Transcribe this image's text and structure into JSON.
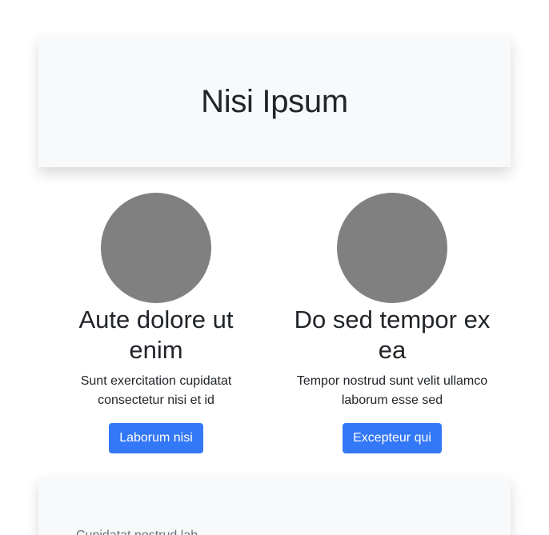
{
  "hero": {
    "title": "Nisi Ipsum"
  },
  "features": [
    {
      "title": "Aute dolore ut enim",
      "text": "Sunt exercitation cupidatat consectetur nisi et id",
      "button_label": "Laborum nisi"
    },
    {
      "title": "Do sed tempor ex ea",
      "text": "Tempor nostrud sunt velit ullamco laborum esse sed",
      "button_label": "Excepteur qui"
    }
  ],
  "footer": {
    "text": "Cupidatat nostrud lab..."
  },
  "colors": {
    "accent": "#3378f6",
    "card_background": "#f8f9fa",
    "avatar": "#808080"
  }
}
